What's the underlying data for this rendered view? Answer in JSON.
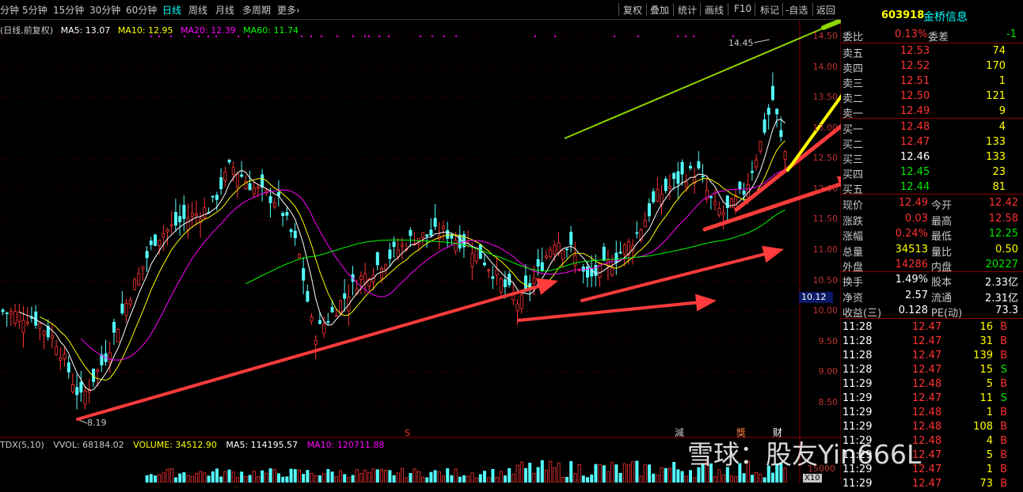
{
  "toolbar": {
    "periods": [
      "分钟",
      "5分钟",
      "15分钟",
      "30分钟",
      "60分钟",
      "日线",
      "周线",
      "月线",
      "多周期",
      "更多›"
    ],
    "active_period": "日线",
    "buttons": [
      "复权",
      "叠加",
      "统计",
      "画线",
      "F10",
      "标记",
      "-自选",
      "返回"
    ]
  },
  "stock": {
    "code": "603918",
    "name": "金桥信息"
  },
  "ma_legend": {
    "title": "(日线,前复权)",
    "ma5": "MA5: 13.07",
    "ma10": "MA10: 12.95",
    "ma20": "MA20: 12.39",
    "ma60": "MA60: 11.74"
  },
  "price_axis": [
    "14.50",
    "14.00",
    "13.50",
    "13.00",
    "12.50",
    "12.00",
    "11.50",
    "11.00",
    "10.50",
    "10.00",
    "9.50",
    "9.00",
    "8.50"
  ],
  "current_price_tag": "10.12",
  "annotations": {
    "high": "14.45",
    "low": "8.19",
    "marker_s": "S",
    "marker_jian": "減",
    "marker_jiang": "獎",
    "marker_cai": "财"
  },
  "quote": {
    "weibi_label": "委比",
    "weibi_value": "0.13%",
    "weicha_label": "委差",
    "weicha_value": "-1",
    "asks": [
      {
        "label": "卖五",
        "price": "12.53",
        "vol": "74"
      },
      {
        "label": "卖四",
        "price": "12.52",
        "vol": "170"
      },
      {
        "label": "卖三",
        "price": "12.51",
        "vol": "1"
      },
      {
        "label": "卖二",
        "price": "12.50",
        "vol": "121"
      },
      {
        "label": "卖一",
        "price": "12.49",
        "vol": "9"
      }
    ],
    "bids": [
      {
        "label": "买一",
        "price": "12.48",
        "vol": "4"
      },
      {
        "label": "买二",
        "price": "12.47",
        "vol": "133"
      },
      {
        "label": "买三",
        "price": "12.46",
        "vol": "133"
      },
      {
        "label": "买四",
        "price": "12.45",
        "vol": "23"
      },
      {
        "label": "买五",
        "price": "12.44",
        "vol": "81"
      }
    ],
    "stats": [
      {
        "l1": "现价",
        "v1": "12.49",
        "l2": "今开",
        "v2": "12.42"
      },
      {
        "l1": "涨跌",
        "v1": "0.03",
        "l2": "最高",
        "v2": "12.58"
      },
      {
        "l1": "涨幅",
        "v1": "0.24%",
        "l2": "最低",
        "v2": "12.25"
      },
      {
        "l1": "总量",
        "v1": "34513",
        "l2": "量比",
        "v2": "0.50"
      },
      {
        "l1": "外盘",
        "v1": "14286",
        "l2": "内盘",
        "v2": "20227"
      }
    ],
    "fundamentals": [
      {
        "l1": "换手",
        "v1": "1.49%",
        "l2": "股本",
        "v2": "2.33亿"
      },
      {
        "l1": "净资",
        "v1": "2.57",
        "l2": "流通",
        "v2": "2.31亿"
      },
      {
        "l1": "收益(三)",
        "v1": "0.128",
        "l2": "PE(动)",
        "v2": "73.3"
      }
    ],
    "ticks": [
      {
        "time": "11:28",
        "price": "12.47",
        "vol": "16",
        "side": "B"
      },
      {
        "time": "11:28",
        "price": "12.47",
        "vol": "31",
        "side": "B"
      },
      {
        "time": "11:28",
        "price": "12.47",
        "vol": "139",
        "side": "B"
      },
      {
        "time": "11:28",
        "price": "12.47",
        "vol": "15",
        "side": "S"
      },
      {
        "time": "11:29",
        "price": "12.48",
        "vol": "5",
        "side": "B"
      },
      {
        "time": "11:29",
        "price": "12.47",
        "vol": "11",
        "side": "S"
      },
      {
        "time": "11:29",
        "price": "12.48",
        "vol": "1",
        "side": "B"
      },
      {
        "time": "11:29",
        "price": "12.48",
        "vol": "108",
        "side": "B"
      },
      {
        "time": "11:29",
        "price": "12.48",
        "vol": "4",
        "side": "B"
      },
      {
        "time": "11:29",
        "price": "12.47",
        "vol": "5",
        "side": "B"
      },
      {
        "time": "11:29",
        "price": "12.47",
        "vol": "1",
        "side": "B"
      },
      {
        "time": "11:29",
        "price": "12.47",
        "vol": "73",
        "side": "B"
      }
    ]
  },
  "volume_legend": {
    "title": "TDX(5,10)",
    "vvol": "VVOL: 68184.02",
    "volume": "VOLUME: 34512.90",
    "ma5": "MA5: 114195.57",
    "ma10": "MA10: 120711.88"
  },
  "volume_axis": [
    "15000",
    "X10"
  ],
  "watermark": "雪球：股友Yin666L",
  "colors": {
    "up": "#ff3232",
    "down": "#54ffff",
    "ma5": "#ffffff",
    "ma10": "#ffff00",
    "ma20": "#ff00ff",
    "ma60": "#00ff00",
    "arrow_red": "#ff3b3b",
    "arrow_green": "#8fd400",
    "arrow_yellow": "#ffff00"
  }
}
